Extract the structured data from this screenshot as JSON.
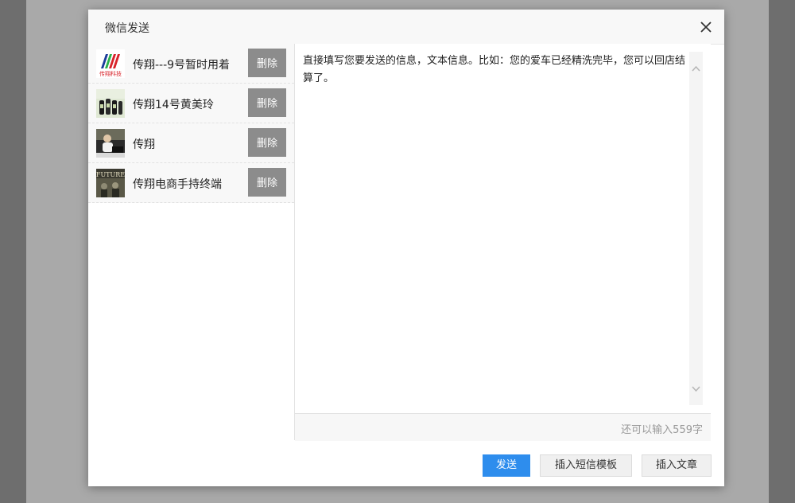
{
  "dialog": {
    "title": "微信发送"
  },
  "contacts": [
    {
      "name": "传翔---9号暂时用着",
      "avatar": "logo-avatar",
      "avatar_caption": "传翔科技",
      "delete_label": "删除"
    },
    {
      "name": "传翔14号黄美玲",
      "avatar": "bottles-avatar",
      "delete_label": "删除"
    },
    {
      "name": "传翔",
      "avatar": "person-avatar",
      "delete_label": "删除"
    },
    {
      "name": "传翔电商手持终端",
      "avatar": "movie-poster-avatar",
      "avatar_caption": "FUTURE",
      "delete_label": "删除"
    }
  ],
  "editor": {
    "text": "直接填写您要发送的信息，文本信息。比如：您的爱车已经精洗完毕，您可以回店结算了。",
    "counter": "还可以输入559字"
  },
  "footer": {
    "send_label": "发送",
    "insert_template_label": "插入短信模板",
    "insert_article_label": "插入文章"
  },
  "colors": {
    "primary": "#2e8ded",
    "delete_button": "#8c8c8c",
    "overlay": "#6e6e6e"
  }
}
